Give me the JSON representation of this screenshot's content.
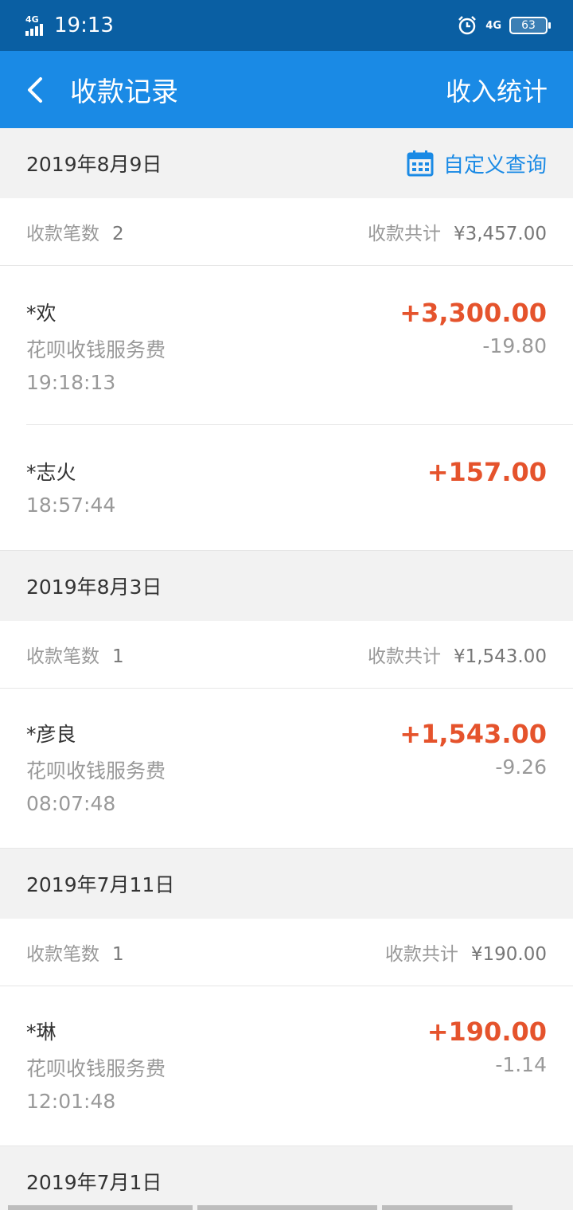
{
  "status_bar": {
    "network": "4G",
    "time": "19:13",
    "network_right": "4G",
    "battery": "63"
  },
  "nav": {
    "title": "收款记录",
    "right_action": "收入统计"
  },
  "custom_query": "自定义查询",
  "summary_labels": {
    "count": "收款笔数",
    "total": "收款共计"
  },
  "groups": [
    {
      "date": "2019年8月9日",
      "count": "2",
      "total": "¥3,457.00",
      "records": [
        {
          "name": "*欢",
          "desc": "花呗收钱服务费",
          "time": "19:18:13",
          "amount": "+3,300.00",
          "fee": "-19.80"
        },
        {
          "name": "*志火",
          "time": "18:57:44",
          "amount": "+157.00"
        }
      ]
    },
    {
      "date": "2019年8月3日",
      "count": "1",
      "total": "¥1,543.00",
      "records": [
        {
          "name": "*彦良",
          "desc": "花呗收钱服务费",
          "time": "08:07:48",
          "amount": "+1,543.00",
          "fee": "-9.26"
        }
      ]
    },
    {
      "date": "2019年7月11日",
      "count": "1",
      "total": "¥190.00",
      "records": [
        {
          "name": "*琳",
          "desc": "花呗收钱服务费",
          "time": "12:01:48",
          "amount": "+190.00",
          "fee": "-1.14"
        }
      ]
    },
    {
      "date": "2019年7月1日"
    }
  ],
  "colors": {
    "status_bar": "#0a5fa3",
    "nav_bar": "#1a8ae5",
    "amount": "#e5532c",
    "accent": "#1a8ae5"
  }
}
